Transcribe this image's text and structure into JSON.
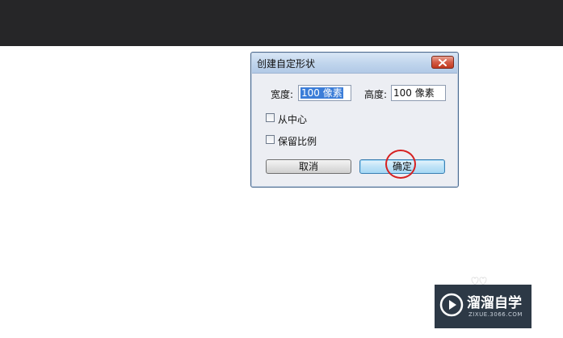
{
  "dialog": {
    "title": "创建自定形状",
    "width_label": "宽度:",
    "width_value_selected": "100 像素",
    "height_label": "高度:",
    "height_value": "100 像素",
    "checkboxes": [
      {
        "label": "从中心",
        "checked": false
      },
      {
        "label": "保留比例",
        "checked": false
      }
    ],
    "cancel_label": "取消",
    "ok_label": "确定"
  },
  "watermark": {
    "title": "溜溜自学",
    "url": "ZIXUE.3066.COM"
  },
  "colors": {
    "topbar": "#262628",
    "highlight": "#d62020",
    "selection": "#3b7dd8"
  }
}
